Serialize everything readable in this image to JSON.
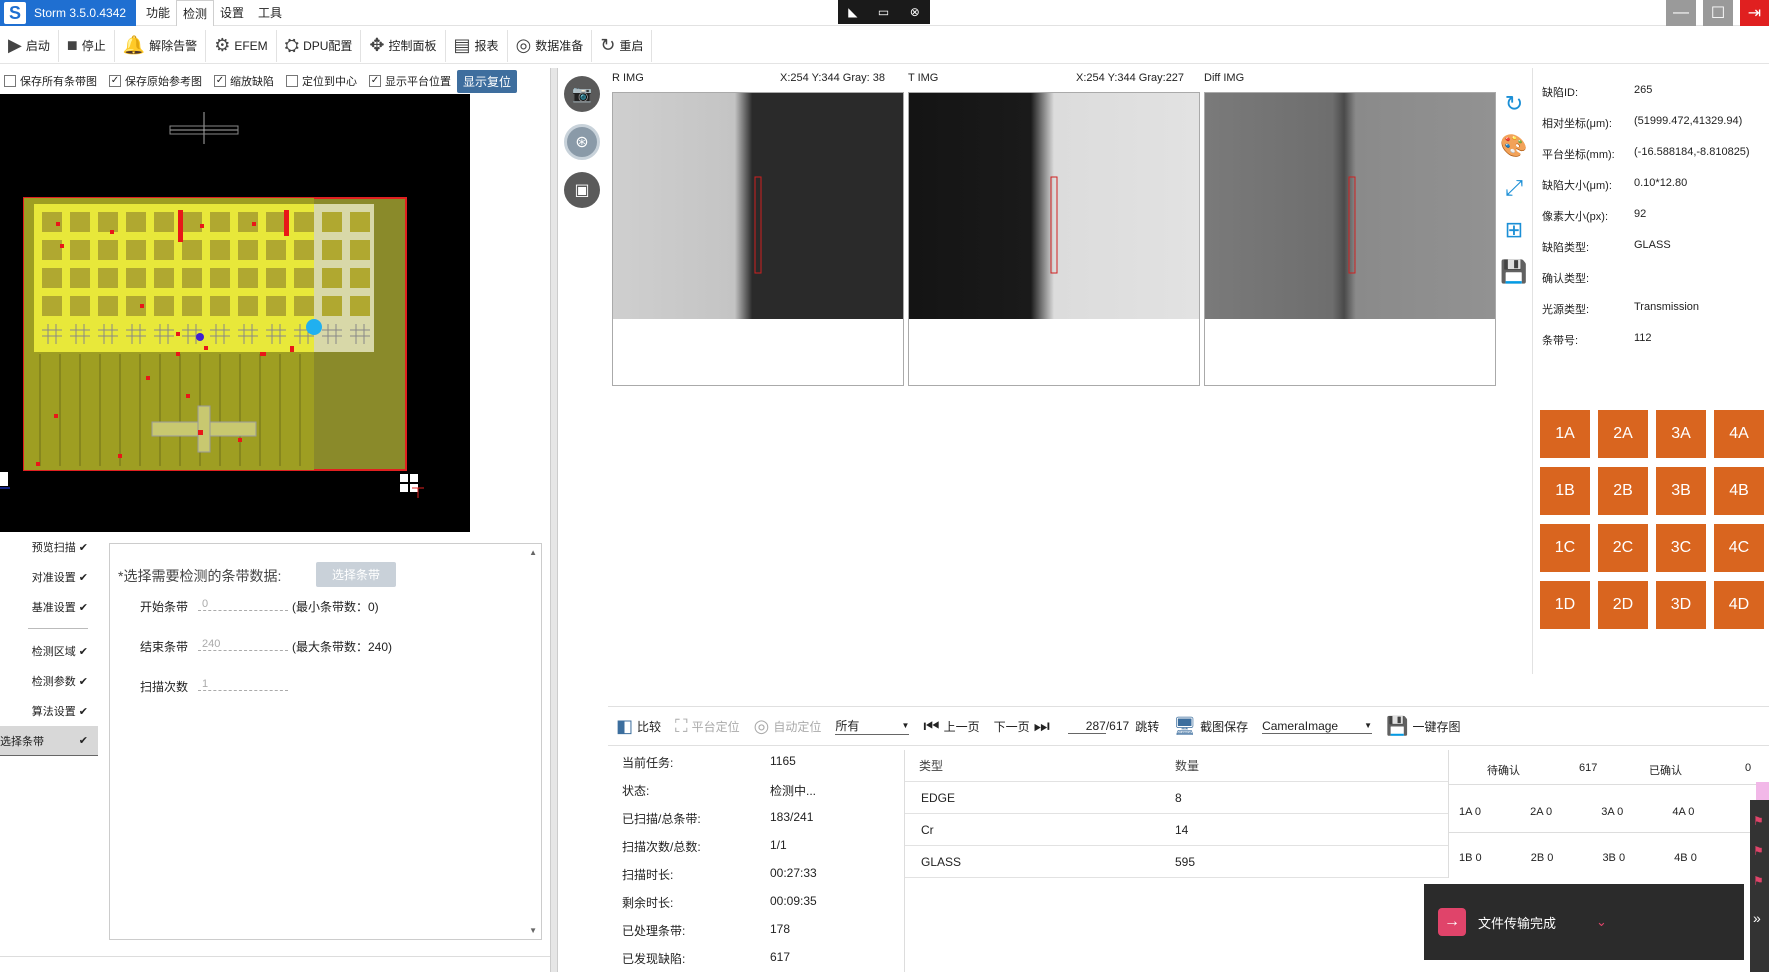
{
  "app": {
    "title": "Storm 3.5.0.4342",
    "logo_letter": "S"
  },
  "menu": [
    "功能",
    "检测",
    "设置",
    "工具"
  ],
  "toolbar": [
    {
      "label": "启动",
      "icon": "▶"
    },
    {
      "label": "停止",
      "icon": "■"
    },
    {
      "label": "解除告警",
      "icon": "🔔"
    },
    {
      "label": "EFEM",
      "icon": "⚙"
    },
    {
      "label": "DPU配置",
      "icon": "⛭"
    },
    {
      "label": "控制面板",
      "icon": "✥"
    },
    {
      "label": "报表",
      "icon": "▤"
    },
    {
      "label": "数据准备",
      "icon": "◎"
    },
    {
      "label": "重启",
      "icon": "↻"
    }
  ],
  "checks": [
    {
      "label": "保存所有条带图",
      "checked": false
    },
    {
      "label": "保存原始参考图",
      "checked": true
    },
    {
      "label": "缩放缺陷",
      "checked": true
    },
    {
      "label": "定位到中心",
      "checked": false
    },
    {
      "label": "显示平台位置",
      "checked": true
    }
  ],
  "show_reset": "显示复位",
  "steps": [
    "预览扫描",
    "对准设置",
    "基准设置",
    "检测区域",
    "检测参数",
    "算法设置",
    "选择条带"
  ],
  "form": {
    "prompt": "*选择需要检测的条带数据:",
    "select_btn": "选择条带",
    "start_label": "开始条带",
    "start_val": "0",
    "start_hint": "(最小条带数：0)",
    "end_label": "结束条带",
    "end_val": "240",
    "end_hint": "(最大条带数：240)",
    "scan_label": "扫描次数",
    "scan_val": "1"
  },
  "images": {
    "r": {
      "title": "R IMG",
      "coord": "X:254 Y:344 Gray: 38"
    },
    "t": {
      "title": "T IMG",
      "coord": "X:254 Y:344 Gray:227"
    },
    "d": {
      "title": "Diff IMG",
      "coord": ""
    }
  },
  "defect": [
    {
      "k": "缺陷ID:",
      "v": "265"
    },
    {
      "k": "相对坐标(μm):",
      "v": "(51999.472,41329.94)"
    },
    {
      "k": "平台坐标(mm):",
      "v": "(-16.588184,-8.810825)"
    },
    {
      "k": "缺陷大小(μm):",
      "v": "0.10*12.80"
    },
    {
      "k": "像素大小(px):",
      "v": "92"
    },
    {
      "k": "缺陷类型:",
      "v": "GLASS"
    },
    {
      "k": "确认类型:",
      "v": ""
    },
    {
      "k": "光源类型:",
      "v": "Transmission"
    },
    {
      "k": "条带号:",
      "v": "112"
    }
  ],
  "cameras": [
    "1A",
    "2A",
    "3A",
    "4A",
    "1B",
    "2B",
    "3B",
    "4B",
    "1C",
    "2C",
    "3C",
    "4C",
    "1D",
    "2D",
    "3D",
    "4D"
  ],
  "bottom": {
    "compare": "比较",
    "platform": "平台定位",
    "auto": "自动定位",
    "filter": "所有",
    "prev": "上一页",
    "next": "下一页",
    "page": "287",
    "total": "/617",
    "jump": "跳转",
    "capture": "截图保存",
    "image_sel": "CameraImage",
    "save_all": "一键存图"
  },
  "stats": [
    {
      "k": "当前任务:",
      "v": "1165"
    },
    {
      "k": "状态:",
      "v": "检测中..."
    },
    {
      "k": "已扫描/总条带:",
      "v": "183/241"
    },
    {
      "k": "扫描次数/总数:",
      "v": "1/1"
    },
    {
      "k": "扫描时长:",
      "v": "00:27:33"
    },
    {
      "k": "剩余时长:",
      "v": "00:09:35"
    },
    {
      "k": "已处理条带:",
      "v": "178"
    },
    {
      "k": "已发现缺陷:",
      "v": "617"
    }
  ],
  "types": {
    "header": [
      "类型",
      "数量"
    ],
    "rows": [
      {
        "t": "EDGE",
        "n": "8"
      },
      {
        "t": "Cr",
        "n": "14"
      },
      {
        "t": "GLASS",
        "n": "595"
      }
    ]
  },
  "confirm": {
    "pending_label": "待确认",
    "pending": "617",
    "done_label": "已确认",
    "done": "0",
    "row1": [
      {
        "k": "1A",
        "v": "0"
      },
      {
        "k": "2A",
        "v": "0"
      },
      {
        "k": "3A",
        "v": "0"
      },
      {
        "k": "4A",
        "v": "0"
      }
    ],
    "row2": [
      {
        "k": "1B",
        "v": "0"
      },
      {
        "k": "2B",
        "v": "0"
      },
      {
        "k": "3B",
        "v": "0"
      },
      {
        "k": "4B",
        "v": "0"
      }
    ]
  },
  "toast": "文件传输完成"
}
